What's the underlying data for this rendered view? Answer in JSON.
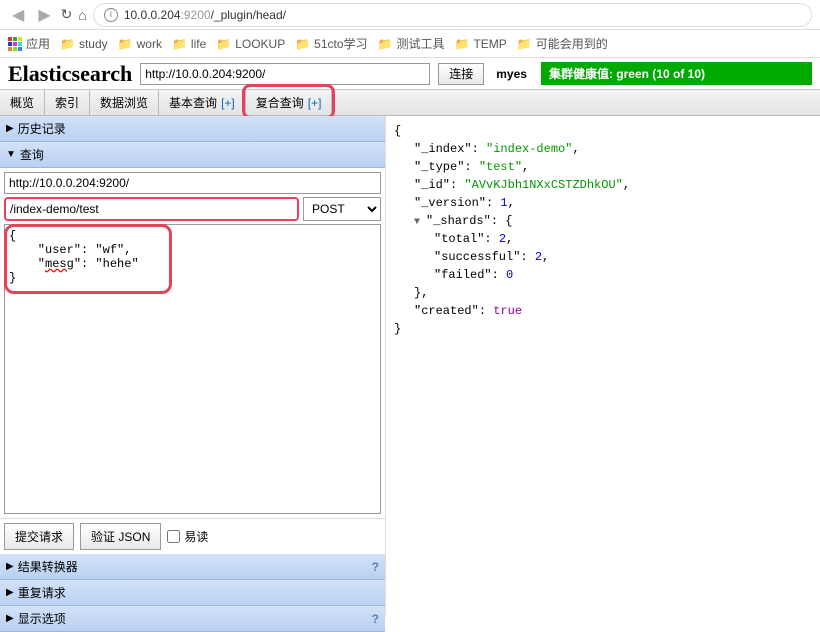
{
  "browser": {
    "url_host": "10.0.0.204",
    "url_port": ":9200",
    "url_path": "/_plugin/head/"
  },
  "bookmarks": {
    "apps": "应用",
    "items": [
      "study",
      "work",
      "life",
      "LOOKUP",
      "51cto学习",
      "测试工具",
      "TEMP",
      "可能会用到的"
    ]
  },
  "header": {
    "logo": "Elasticsearch",
    "connect_url": "http://10.0.0.204:9200/",
    "connect_btn": "连接",
    "cluster_name": "myes",
    "health": "集群健康值: green (10 of 10)"
  },
  "tabs": {
    "overview": "概览",
    "indices": "索引",
    "browse": "数据浏览",
    "basic": "基本查询",
    "basic_plus": "[+]",
    "compound": "复合查询",
    "compound_plus": "[+]"
  },
  "sections": {
    "history": "历史记录",
    "query": "查询",
    "transformer": "结果转换器",
    "repeat": "重复请求",
    "display": "显示选项"
  },
  "query": {
    "server": "http://10.0.0.204:9200/",
    "path": "/index-demo/test",
    "method": "POST",
    "body_line1": "{",
    "body_line2": "    \"user\": \"wf\",",
    "body_line3_pre": "    \"",
    "body_line3_mesg": "mesg",
    "body_line3_post": "\": \"hehe\"",
    "body_line4": "}",
    "submit": "提交请求",
    "validate": "验证 JSON",
    "pretty": "易读"
  },
  "response": {
    "index_k": "\"_index\"",
    "index_v": "\"index-demo\"",
    "type_k": "\"_type\"",
    "type_v": "\"test\"",
    "id_k": "\"_id\"",
    "id_v": "\"AVvKJbh1NXxCSTZDhkOU\"",
    "version_k": "\"_version\"",
    "version_v": "1",
    "shards_k": "\"_shards\"",
    "total_k": "\"total\"",
    "total_v": "2",
    "success_k": "\"successful\"",
    "success_v": "2",
    "failed_k": "\"failed\"",
    "failed_v": "0",
    "created_k": "\"created\"",
    "created_v": "true"
  }
}
